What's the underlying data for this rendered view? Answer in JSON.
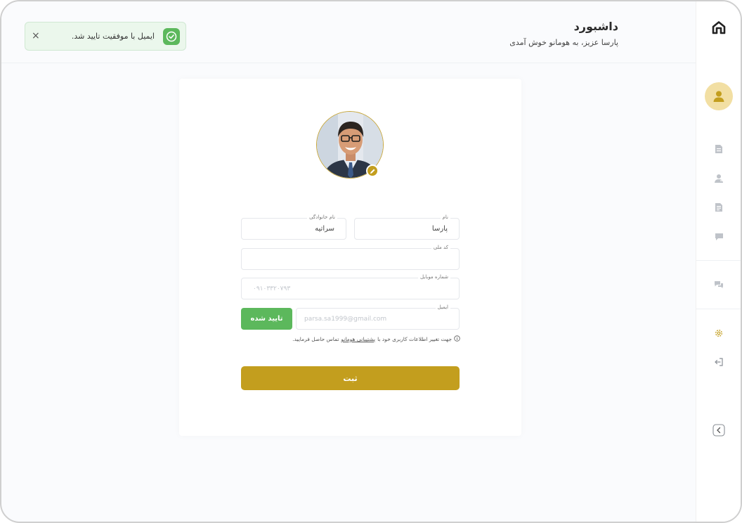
{
  "header": {
    "title": "داشبورد",
    "subtitle": "پارسا عزیز، به هومانو خوش آمدی"
  },
  "toast": {
    "message": "ایمیل با موفقیت تایید شد.",
    "close_label": "×",
    "icon": "check-icon",
    "color": "#5cb85c"
  },
  "sidebar": {
    "items": [
      {
        "name": "home",
        "icon": "home-icon"
      },
      {
        "name": "profile",
        "icon": "user-icon"
      },
      {
        "name": "documents",
        "icon": "document-icon"
      },
      {
        "name": "users",
        "icon": "user-add-icon"
      },
      {
        "name": "reports",
        "icon": "file-icon"
      },
      {
        "name": "messages",
        "icon": "chat-icon"
      },
      {
        "name": "support",
        "icon": "chats-icon"
      },
      {
        "name": "settings",
        "icon": "gear-icon"
      },
      {
        "name": "logout",
        "icon": "logout-icon"
      },
      {
        "name": "collapse",
        "icon": "chevron-left-icon"
      }
    ]
  },
  "form": {
    "first_name": {
      "label": "نام",
      "value": "پارسا"
    },
    "last_name": {
      "label": "نام خانوادگی",
      "value": "سراتیه"
    },
    "national_code": {
      "label": "کد ملی",
      "value": ""
    },
    "mobile": {
      "label": "شماره موبایل",
      "placeholder": "۰۹۱۰۳۳۲۰۷۹۳"
    },
    "email": {
      "label": "ایمیل",
      "placeholder": "parsa.sa1999@gmail.com"
    },
    "verify_button": "تایید شده",
    "hint_prefix": "جهت تغییر اطلاعات کاربری خود با",
    "hint_link": "پشتیبانی هومانو",
    "hint_suffix": "تماس حاصل فرمایید.",
    "submit_button": "ثبت"
  },
  "colors": {
    "accent": "#c39e1e",
    "success": "#5cb85c",
    "avatar_bg": "#f2dfa3"
  }
}
